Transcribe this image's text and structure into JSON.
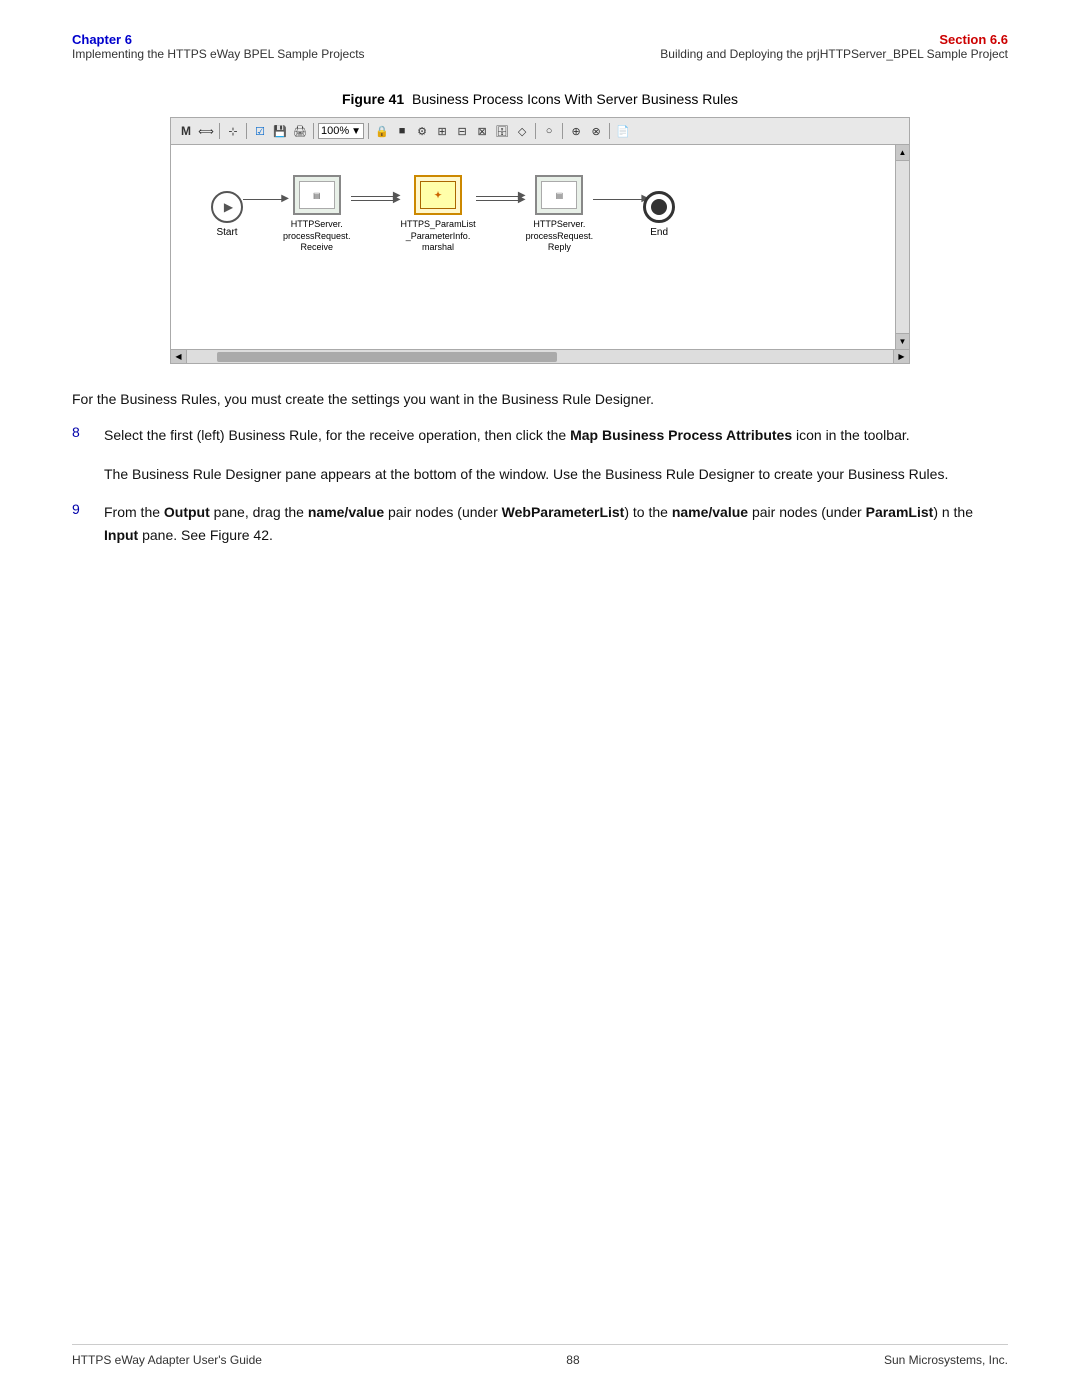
{
  "header": {
    "chapter_label": "Chapter 6",
    "chapter_sub": "Implementing the HTTPS eWay BPEL Sample Projects",
    "section_label": "Section 6.6",
    "section_sub": "Building and Deploying the prjHTTPServer_BPEL Sample Project"
  },
  "figure": {
    "number": "41",
    "caption": "Business Process Icons With Server Business Rules",
    "toolbar": {
      "zoom_value": "100%"
    },
    "nodes": [
      {
        "id": "start",
        "label": "Start"
      },
      {
        "id": "http_receive",
        "label": "HTTPServer.\nprocessRequest.\nReceive"
      },
      {
        "id": "https_paramlist",
        "label": "HTTPS_ParamList\n_ParameterInfo.\nmarshal"
      },
      {
        "id": "http_reply",
        "label": "HTTPServer.\nprocessRequest.\nReply"
      },
      {
        "id": "end",
        "label": "End"
      }
    ]
  },
  "body_intro": "For the Business Rules, you must create the settings you want in the Business Rule Designer.",
  "steps": [
    {
      "number": "8",
      "text": "Select the first (left) Business Rule, for the receive operation, then click the ",
      "bold1": "Map Business Process Attributes",
      "text2": " icon in the toolbar.",
      "sub_text": "The Business Rule Designer pane appears at the bottom of the window. Use the Business Rule Designer to create your Business Rules."
    },
    {
      "number": "9",
      "text": "From the ",
      "bold1": "Output",
      "text2": " pane, drag the ",
      "bold2": "name/value",
      "text3": " pair nodes (under ",
      "bold3": "WebParameterList",
      "text4": ") to the ",
      "bold4": "name/value",
      "text5": " pair nodes (under ",
      "bold5": "ParamList",
      "text6": ") n the ",
      "bold6": "Input",
      "text7": " pane. See Figure 42."
    }
  ],
  "footer": {
    "left": "HTTPS eWay Adapter User's Guide",
    "center": "88",
    "right": "Sun Microsystems, Inc."
  }
}
